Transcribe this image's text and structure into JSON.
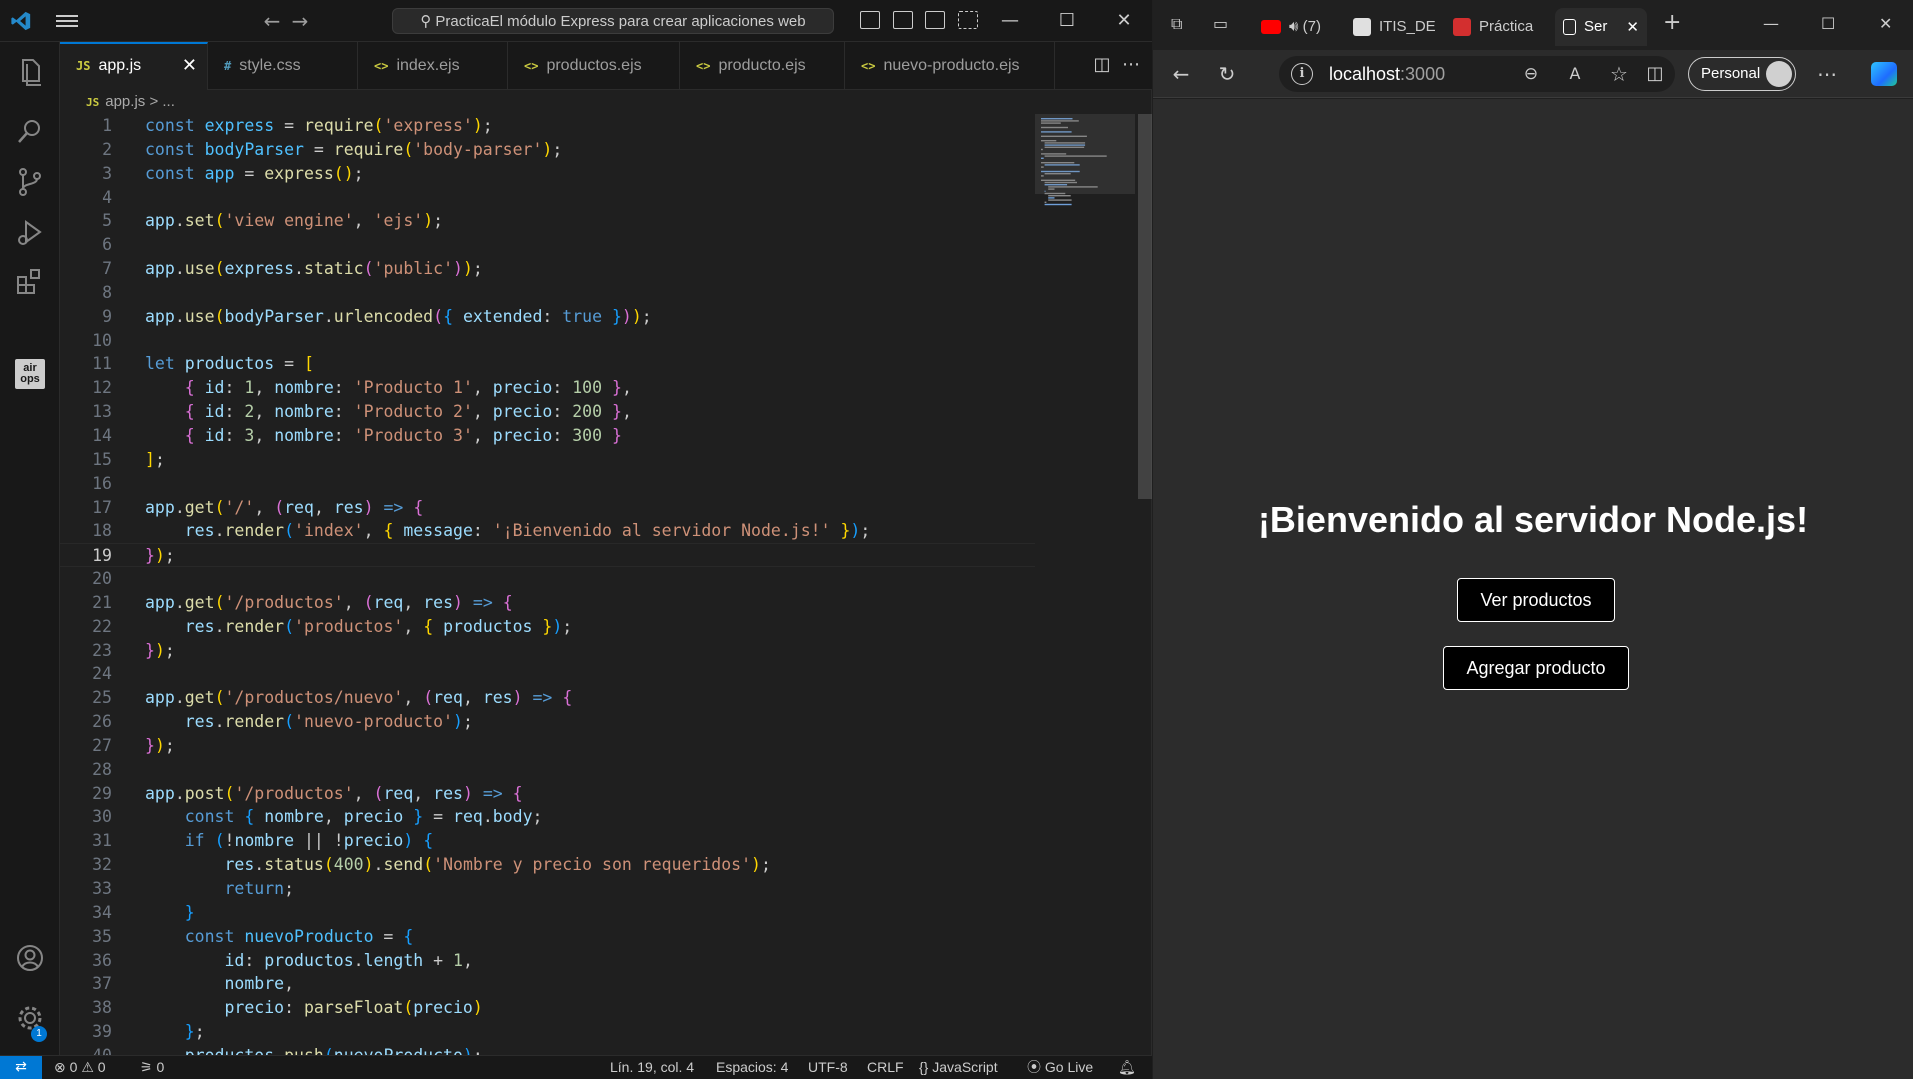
{
  "vscode": {
    "command_center": "PracticaEl módulo Express para crear aplicaciones web",
    "tabs": [
      {
        "icon": "JS",
        "label": "app.js",
        "active": true
      },
      {
        "icon": "#",
        "label": "style.css"
      },
      {
        "icon": "<>",
        "label": "index.ejs"
      },
      {
        "icon": "<>",
        "label": "productos.ejs"
      },
      {
        "icon": "<>",
        "label": "producto.ejs"
      },
      {
        "icon": "<>",
        "label": "nuevo-producto.ejs"
      }
    ],
    "breadcrumb": {
      "file": "app.js",
      "sep": ">",
      "rest": "..."
    },
    "activity_badge": "1",
    "airops_label": "air ops",
    "current_line": 19,
    "code_lines": [
      "const express = require('express');",
      "const bodyParser = require('body-parser');",
      "const app = express();",
      "",
      "app.set('view engine', 'ejs');",
      "",
      "app.use(express.static('public'));",
      "",
      "app.use(bodyParser.urlencoded({ extended: true }));",
      "",
      "let productos = [",
      "    { id: 1, nombre: 'Producto 1', precio: 100 },",
      "    { id: 2, nombre: 'Producto 2', precio: 200 },",
      "    { id: 3, nombre: 'Producto 3', precio: 300 }",
      "];",
      "",
      "app.get('/', (req, res) => {",
      "    res.render('index', { message: '¡Bienvenido al servidor Node.js!' });",
      "});",
      "",
      "app.get('/productos', (req, res) => {",
      "    res.render('productos', { productos });",
      "});",
      "",
      "app.get('/productos/nuevo', (req, res) => {",
      "    res.render('nuevo-producto');",
      "});",
      "",
      "app.post('/productos', (req, res) => {",
      "    const { nombre, precio } = req.body;",
      "    if (!nombre || !precio) {",
      "        res.status(400).send('Nombre y precio son requeridos');",
      "        return;",
      "    }",
      "    const nuevoProducto = {",
      "        id: productos.length + 1,",
      "        nombre,",
      "        precio: parseFloat(precio)",
      "    };",
      "    productos.push(nuevoProducto);"
    ],
    "status": {
      "errors": "0",
      "warnings": "0",
      "ports": "0",
      "position": "Lín. 19, col. 4",
      "spaces": "Espacios: 4",
      "encoding": "UTF-8",
      "eol": "CRLF",
      "language": "JavaScript",
      "golive": "Go Live"
    }
  },
  "edge": {
    "tabs": [
      {
        "label": "(7)",
        "icon": "youtube"
      },
      {
        "label": "ITIS_DE",
        "icon": "site"
      },
      {
        "label": "Práctica",
        "icon": "pdf"
      },
      {
        "label": "Ser",
        "icon": "page",
        "active": true
      }
    ],
    "address": {
      "host": "localhost",
      "port": ":3000"
    },
    "profile": "Personal",
    "page": {
      "heading": "¡Bienvenido al servidor Node.js!",
      "buttons": [
        "Ver productos",
        "Agregar producto"
      ]
    }
  }
}
